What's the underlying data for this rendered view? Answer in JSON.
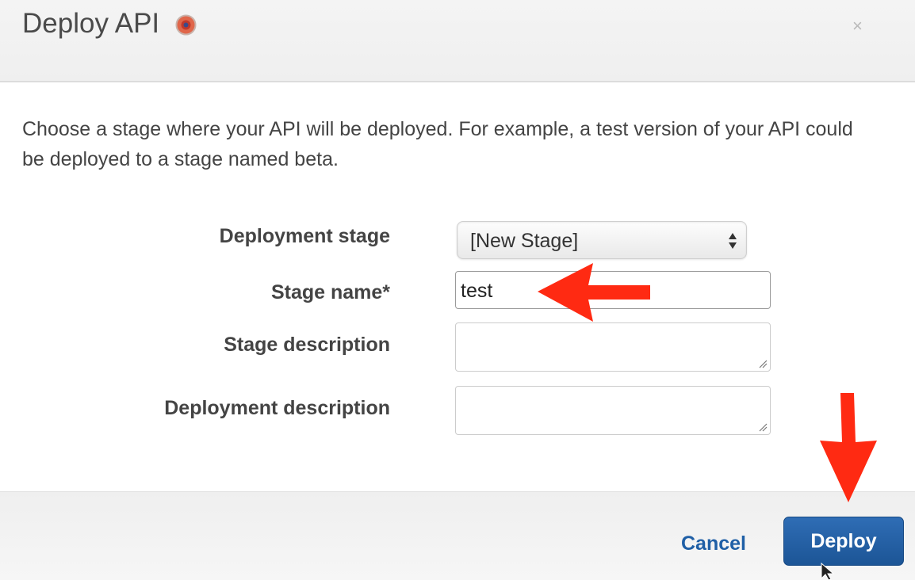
{
  "dialog": {
    "title": "Deploy API",
    "help_icon": "help-info-icon",
    "close_label": "×",
    "intro": "Choose a stage where your API will be deployed. For example, a test version of your API could be deployed to a stage named beta."
  },
  "form": {
    "deployment_stage": {
      "label": "Deployment stage",
      "selected": "[New Stage]"
    },
    "stage_name": {
      "label": "Stage name*",
      "value": "test"
    },
    "stage_description": {
      "label": "Stage description",
      "value": ""
    },
    "deployment_description": {
      "label": "Deployment description",
      "value": ""
    }
  },
  "footer": {
    "cancel_label": "Cancel",
    "deploy_label": "Deploy"
  },
  "colors": {
    "primary_button": "#1f5ea3",
    "link": "#1f5fa6",
    "annotation_arrow": "#ff2a12"
  },
  "icons": [
    "help-info-icon",
    "close-icon",
    "select-arrows-icon",
    "resize-grip-icon",
    "cursor-arrow-icon",
    "annotation-arrow-icon"
  ]
}
